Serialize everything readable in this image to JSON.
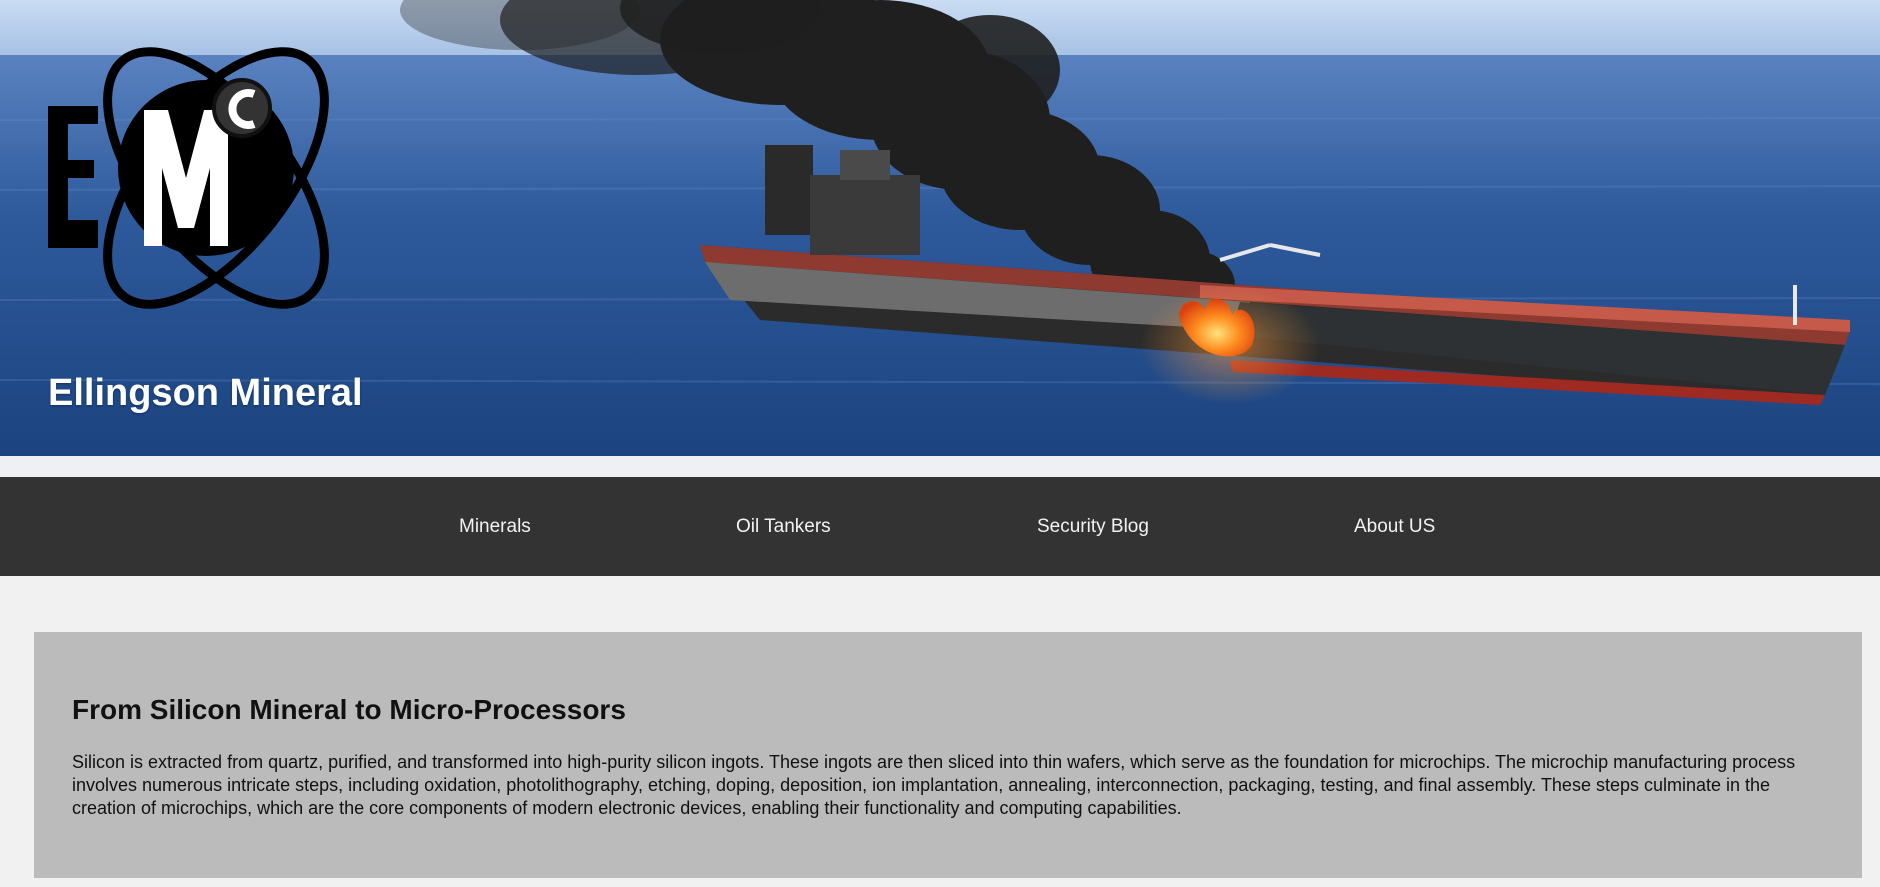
{
  "header": {
    "company_name": "Ellingson Mineral",
    "logo": {
      "letters": [
        "E",
        "M",
        "C"
      ],
      "icon": "emc-atom-logo"
    },
    "banner_image": "burning-oil-tanker-at-sea"
  },
  "nav": {
    "items": [
      {
        "label": "Minerals"
      },
      {
        "label": "Oil Tankers"
      },
      {
        "label": "Security Blog"
      },
      {
        "label": "About US"
      }
    ]
  },
  "article": {
    "title": "From Silicon Mineral to Micro-Processors",
    "body": "Silicon is extracted from quartz, purified, and transformed into high-purity silicon ingots. These ingots are then sliced into thin wafers, which serve as the foundation for microchips. The microchip manufacturing process involves numerous intricate steps, including oxidation, photolithography, etching, doping, deposition, ion implantation, annealing, interconnection, packaging, testing, and final assembly. These steps culminate in the creation of microchips, which are the core components of modern electronic devices, enabling their functionality and computing capabilities."
  },
  "colors": {
    "nav_background": "#333333",
    "page_background": "#f1f1f1",
    "card_background": "#bbbbbb",
    "nav_text": "#f2f2f2"
  }
}
